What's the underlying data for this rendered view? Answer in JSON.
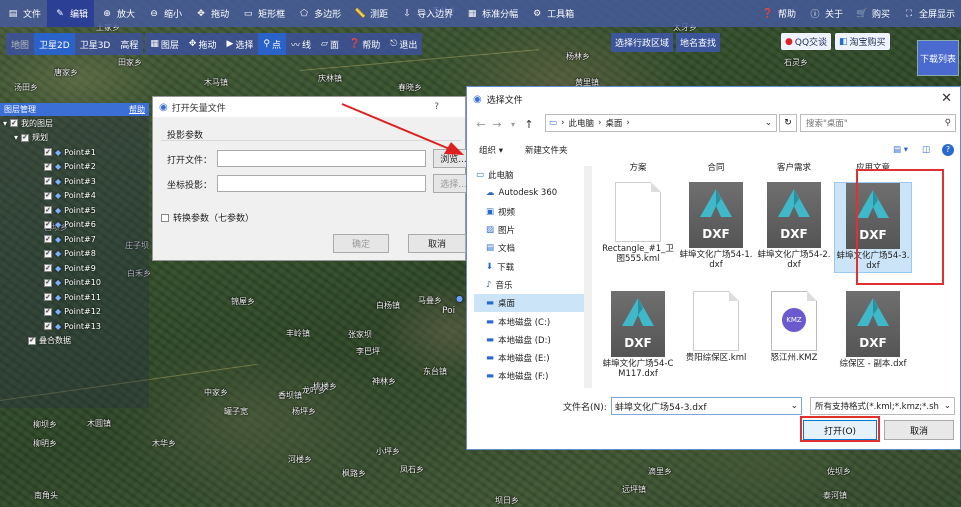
{
  "map": {
    "places": [
      "田家乡",
      "唐家乡",
      "木马镇",
      "庆林镇",
      "春晓乡",
      "土家乡",
      "燕林乡",
      "杨林乡",
      "黄里镇",
      "石灵乡",
      "汤田乡",
      "庄子坝",
      "吉坝乡",
      "白禾乡",
      "锦屋乡",
      "白杨镇",
      "马叠乡",
      "丰岭镇",
      "张家坝",
      "李巴坪",
      "东台镇",
      "龙叶乡",
      "柳坝乡",
      "桃楼乡",
      "神林乡",
      "香坝镇",
      "中家乡",
      "罐子宽",
      "木圆镇",
      "杨坪乡",
      "太牙乡",
      "柳明乡",
      "木华乡",
      "河楼乡",
      "凤石乡",
      "小坪乡",
      "枫路乡",
      "滴里乡",
      "南角头",
      "坝日乡",
      "远坪镇",
      "佐坝乡",
      "泰河镇"
    ],
    "point_label": "Poi"
  },
  "toolbar": {
    "items": [
      {
        "icon": "file-icon",
        "label": "文件"
      },
      {
        "icon": "edit-icon",
        "label": "编辑"
      },
      {
        "icon": "zoom-in-icon",
        "label": "放大"
      },
      {
        "icon": "zoom-out-icon",
        "label": "缩小"
      },
      {
        "icon": "pan-icon",
        "label": "拖动"
      },
      {
        "icon": "rectangle-icon",
        "label": "矩形框"
      },
      {
        "icon": "polygon-icon",
        "label": "多边形"
      },
      {
        "icon": "measure-icon",
        "label": "测距"
      },
      {
        "icon": "import-boundary-icon",
        "label": "导入边界"
      },
      {
        "icon": "standard-grid-icon",
        "label": "标准分幅"
      },
      {
        "icon": "toolbox-icon",
        "label": "工具箱"
      },
      {
        "icon": "help-icon",
        "label": "帮助"
      },
      {
        "icon": "about-icon",
        "label": "关于"
      },
      {
        "icon": "purchase-icon",
        "label": "购买"
      },
      {
        "icon": "fullscreen-icon",
        "label": "全屏显示"
      }
    ]
  },
  "maptools": {
    "views": [
      "地图",
      "卫星2D",
      "卫星3D",
      "高程"
    ],
    "tools": [
      "图层",
      "拖动",
      "选择",
      "点",
      "线",
      "面",
      "帮助",
      "退出"
    ],
    "region_select": "选择行政区域",
    "place_search": "地名查找",
    "qq": "QQ交谈",
    "taobao": "淘宝购买",
    "download_list": "下载列表"
  },
  "layer_panel": {
    "title": "图层管理",
    "help": "帮助",
    "root": "我的图层",
    "group": "规划",
    "points": [
      "Point#1",
      "Point#2",
      "Point#3",
      "Point#4",
      "Point#5",
      "Point#6",
      "Point#7",
      "Point#8",
      "Point#9",
      "Point#10",
      "Point#11",
      "Point#12",
      "Point#13"
    ],
    "overlay": "叠合数据"
  },
  "vector_dialog": {
    "title": "打开矢量文件",
    "question": "?",
    "section": "投影参数",
    "open_file_label": "打开文件：",
    "browse": "浏览...",
    "coord_label": "坐标投影：",
    "select": "选择...",
    "convert_params": "转换参数（七参数）",
    "ok": "确定",
    "cancel": "取消"
  },
  "file_dialog": {
    "title": "选择文件",
    "close": "✕",
    "path": [
      "此电脑",
      "桌面"
    ],
    "search_placeholder": "搜索\"桌面\"",
    "organize": "组织 ▾",
    "new_folder": "新建文件夹",
    "sidebar": [
      {
        "icon": "computer-icon",
        "label": "此电脑"
      },
      {
        "icon": "cloud-drive-icon",
        "label": "Autodesk 360"
      },
      {
        "icon": "video-icon",
        "label": "视频"
      },
      {
        "icon": "pictures-icon",
        "label": "图片"
      },
      {
        "icon": "documents-icon",
        "label": "文档"
      },
      {
        "icon": "downloads-icon",
        "label": "下载"
      },
      {
        "icon": "music-icon",
        "label": "音乐"
      },
      {
        "icon": "desktop-icon",
        "label": "桌面"
      },
      {
        "icon": "drive-icon",
        "label": "本地磁盘 (C:)"
      },
      {
        "icon": "drive-icon",
        "label": "本地磁盘 (D:)"
      },
      {
        "icon": "drive-icon",
        "label": "本地磁盘 (E:)"
      },
      {
        "icon": "drive-icon",
        "label": "本地磁盘 (F:)"
      }
    ],
    "folders_top": [
      "方案",
      "合同",
      "客户需求",
      "应用文章"
    ],
    "files": [
      {
        "name": "Rectangle_#1_卫图555.kml",
        "type": "kml"
      },
      {
        "name": "蚌埠文化广场54-1.dxf",
        "type": "dxf"
      },
      {
        "name": "蚌埠文化广场54-2.dxf",
        "type": "dxf"
      },
      {
        "name": "蚌埠文化广场54-3.dxf",
        "type": "dxf"
      },
      {
        "name": "蚌埠文化广场54-CM117.dxf",
        "type": "dxf"
      },
      {
        "name": "贵阳综保区.kml",
        "type": "kml"
      },
      {
        "name": "怒江州.KMZ",
        "type": "kmz"
      },
      {
        "name": "综保区 - 副本.dxf",
        "type": "dxf"
      }
    ],
    "dxf_label": "DXF",
    "filename_label": "文件名(N):",
    "filename_value": "蚌埠文化广场54-3.dxf",
    "filter": "所有支持格式(*.kml;*.kmz;*.sh",
    "open": "打开(O)",
    "cancel": "取消"
  }
}
